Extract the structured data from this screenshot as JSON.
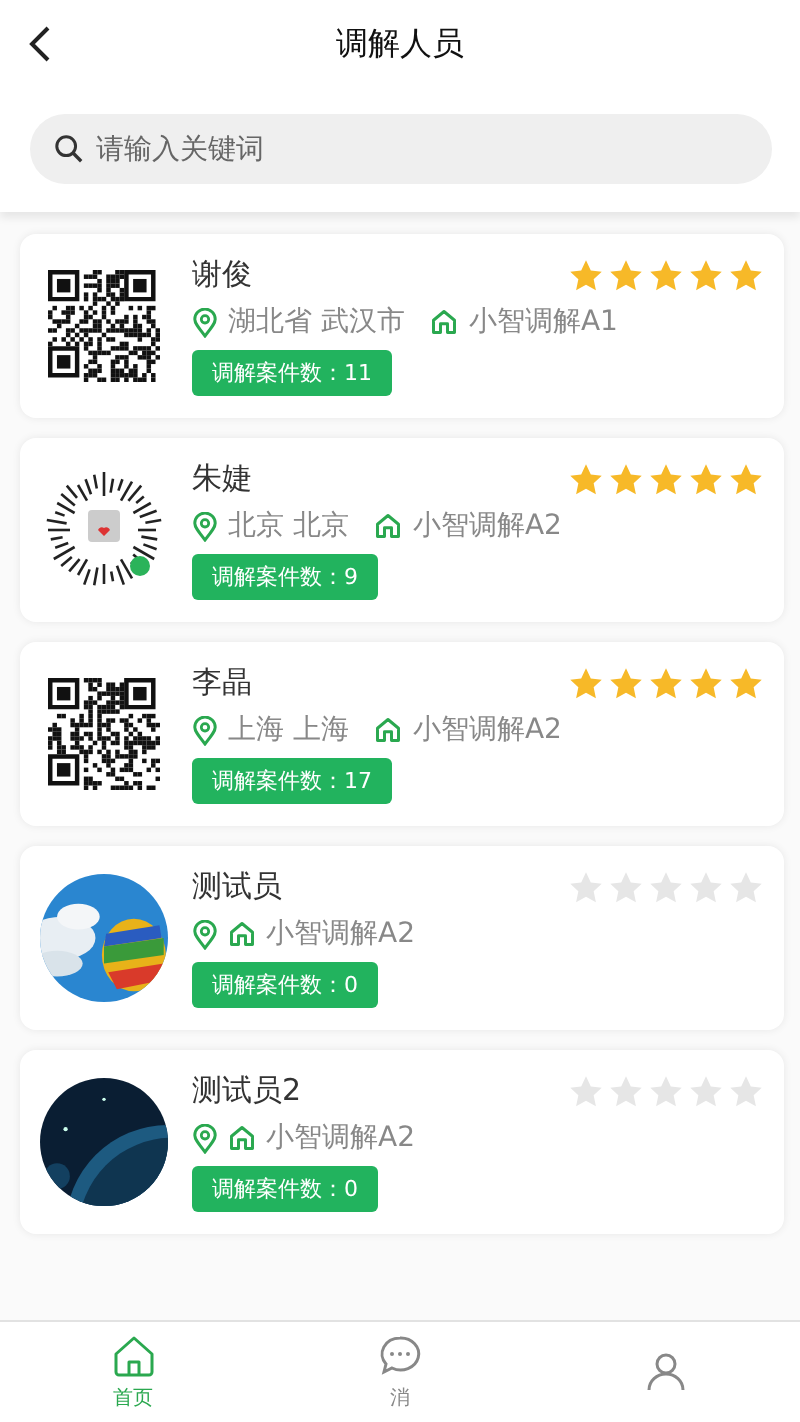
{
  "header": {
    "title": "调解人员"
  },
  "search": {
    "placeholder": "请输入关键词"
  },
  "mediators": [
    {
      "name": "谢俊",
      "avatar": {
        "kind": "qr"
      },
      "stars": 5,
      "location": "湖北省 武汉市",
      "org": "小智调解A1",
      "cases": "调解案件数：11"
    },
    {
      "name": "朱婕",
      "avatar": {
        "kind": "mini-code"
      },
      "stars": 5,
      "location": "北京 北京",
      "org": "小智调解A2",
      "cases": "调解案件数：9"
    },
    {
      "name": "李晶",
      "avatar": {
        "kind": "qr"
      },
      "stars": 5,
      "location": "上海 上海",
      "org": "小智调解A2",
      "cases": "调解案件数：17"
    },
    {
      "name": "测试员",
      "stars": 0,
      "org": "小智调解A2",
      "cases": "调解案件数：0"
    },
    {
      "name": "测试员2",
      "stars": 0,
      "org": "小智调解A2",
      "cases": "调解案件数：0"
    }
  ],
  "tab_bar": [
    {
      "label": "首页",
      "selected": true
    },
    {
      "label": "消",
      "selected": false
    },
    {
      "selected": false
    }
  ]
}
